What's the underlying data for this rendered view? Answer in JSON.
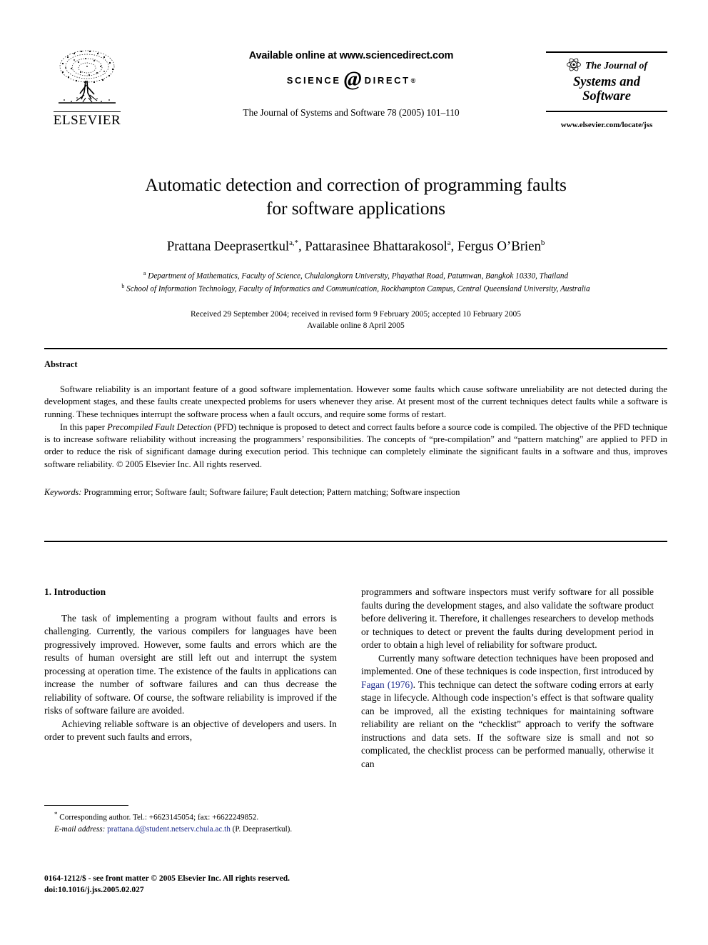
{
  "masthead": {
    "publisher_name": "ELSEVIER",
    "publisher_logo_icon": "elsevier-tree-icon",
    "available_online": "Available online at www.sciencedirect.com",
    "sciencedirect_left": "SCIENCE",
    "sciencedirect_at": "@",
    "sciencedirect_right": "DIRECT",
    "sciencedirect_reg": "®",
    "journal_reference": "The Journal of Systems and Software 78 (2005) 101–110",
    "journal_box": {
      "atom_icon": "atom-icon",
      "line1": "The Journal of",
      "line2": "Systems and",
      "line3": "Software"
    },
    "journal_url": "www.elsevier.com/locate/jss"
  },
  "article": {
    "title_line1": "Automatic detection and correction of programming faults",
    "title_line2": "for software applications",
    "authors": [
      {
        "name": "Prattana Deeprasertkul",
        "marks": "a,*"
      },
      {
        "name": "Pattarasinee Bhattarakosol",
        "marks": "a"
      },
      {
        "name": "Fergus O’Brien",
        "marks": "b"
      }
    ],
    "affiliations": [
      {
        "mark": "a",
        "text": "Department of Mathematics, Faculty of Science, Chulalongkorn University, Phayathai Road, Patumwan, Bangkok 10330, Thailand"
      },
      {
        "mark": "b",
        "text": "School of Information Technology, Faculty of Informatics and Communication, Rockhampton Campus, Central Queensland University, Australia"
      }
    ],
    "dates_line1": "Received 29 September 2004; received in revised form 9 February 2005; accepted 10 February 2005",
    "dates_line2": "Available online 8 April 2005"
  },
  "abstract": {
    "heading": "Abstract",
    "paragraph1": "Software reliability is an important feature of a good software implementation. However some faults which cause software unreliability are not detected during the development stages, and these faults create unexpected problems for users whenever they arise. At present most of the current techniques detect faults while a software is running. These techniques interrupt the software process when a fault occurs, and require some forms of restart.",
    "paragraph2_pre": "In this paper ",
    "paragraph2_italic": "Precompiled Fault Detection",
    "paragraph2_post": " (PFD) technique is proposed to detect and correct faults before a source code is compiled. The objective of the PFD technique is to increase software reliability without increasing the programmers’ responsibilities. The concepts of “pre-compilation” and “pattern matching” are applied to PFD in order to reduce the risk of significant damage during execution period. This technique can completely eliminate the significant faults in a software and thus, improves software reliability. © 2005 Elsevier Inc. All rights reserved.",
    "keywords_label": "Keywords:",
    "keywords_text": "Programming error; Software fault; Software failure; Fault detection; Pattern matching; Software inspection"
  },
  "body": {
    "section1_heading": "1. Introduction",
    "left_p1": "The task of implementing a program without faults and errors is challenging. Currently, the various compilers for languages have been progressively improved. However, some faults and errors which are the results of human oversight are still left out and interrupt the system processing at operation time. The existence of the faults in applications can increase the number of software failures and can thus decrease the reliability of software. Of course, the software reliability is improved if the risks of software failure are avoided.",
    "left_p2": "Achieving reliable software is an objective of developers and users. In order to prevent such faults and errors,",
    "right_p1": "programmers and software inspectors must verify software for all possible faults during the development stages, and also validate the software product before delivering it. Therefore, it challenges researchers to develop methods or techniques to detect or prevent the faults during development period in order to obtain a high level of reliability for software product.",
    "right_p2_pre": "Currently many software detection techniques have been proposed and implemented. One of these techniques is code inspection, first introduced by ",
    "right_p2_cite": "Fagan (1976)",
    "right_p2_post": ". This technique can detect the software coding errors at early stage in lifecycle. Although code inspection’s effect is that software quality can be improved, all the existing techniques for maintaining software reliability are reliant on the “checklist” approach to verify the software instructions and data sets. If the software size is small and not so complicated, the checklist process can be performed manually, otherwise it can"
  },
  "footnote": {
    "star": "*",
    "corresponding": "Corresponding author. Tel.: +6623145054; fax: +6622249852.",
    "email_label": "E-mail address:",
    "email": "prattana.d@student.netserv.chula.ac.th",
    "email_suffix": "(P. Deeprasertkul)."
  },
  "colophon": {
    "issn_line": "0164-1212/$ - see front matter © 2005 Elsevier Inc. All rights reserved.",
    "doi_line": "doi:10.1016/j.jss.2005.02.027"
  },
  "colors": {
    "link": "#1d2b8c",
    "text": "#000000",
    "background": "#ffffff"
  }
}
